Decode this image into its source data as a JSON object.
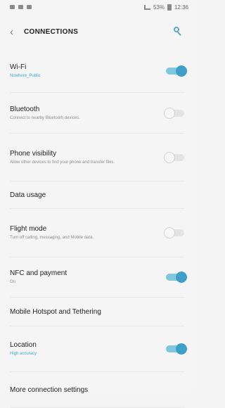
{
  "status": {
    "right_text": "53%",
    "time": "12:36"
  },
  "header": {
    "back_icon": "back-arrow-icon",
    "title": "CONNECTIONS",
    "search_icon": "search-icon"
  },
  "settings": [
    {
      "id": "wifi",
      "label": "Wi-Fi",
      "subtitle": "Nowhere_Public",
      "toggle": "on",
      "subtitle_accent": true
    },
    {
      "id": "bluetooth",
      "label": "Bluetooth",
      "subtitle": "Connect to nearby Bluetooth devices.",
      "toggle": "off"
    },
    {
      "id": "phone-visibility",
      "label": "Phone visibility",
      "subtitle": "Allow other devices to find your phone and transfer files.",
      "toggle": "off"
    },
    {
      "id": "data-usage",
      "label": "Data usage"
    },
    {
      "id": "flight-mode",
      "label": "Flight mode",
      "subtitle": "Turn off calling, messaging, and Mobile data.",
      "toggle": "off"
    },
    {
      "id": "nfc-payment",
      "label": "NFC and payment",
      "subtitle": "On",
      "toggle": "on"
    },
    {
      "id": "hotspot",
      "label": "Mobile Hotspot and Tethering"
    },
    {
      "id": "location",
      "label": "Location",
      "subtitle": "High accuracy",
      "toggle": "on",
      "subtitle_accent": true
    },
    {
      "id": "more-connection",
      "label": "More connection settings"
    }
  ]
}
